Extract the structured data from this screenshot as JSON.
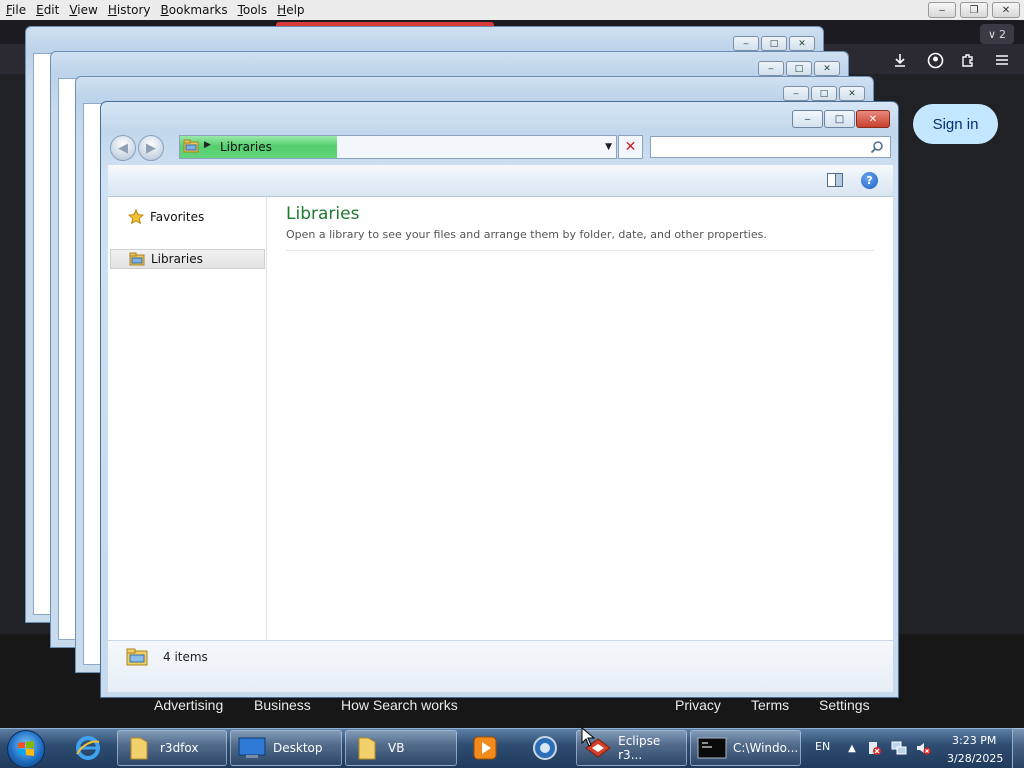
{
  "firefox": {
    "menu": [
      {
        "label": "File",
        "accel": "F",
        "rest": "ile"
      },
      {
        "label": "Edit",
        "accel": "E",
        "rest": "dit"
      },
      {
        "label": "View",
        "accel": "V",
        "rest": "iew"
      },
      {
        "label": "History",
        "accel": "H",
        "rest": "istory"
      },
      {
        "label": "Bookmarks",
        "accel": "B",
        "rest": "ookmarks"
      },
      {
        "label": "Tools",
        "accel": "T",
        "rest": "ools"
      },
      {
        "label": "Help",
        "accel": "H",
        "rest": "elp"
      }
    ],
    "tab_count": "2",
    "sign_in": "Sign in",
    "footer_links": [
      "Advertising",
      "Business",
      "How Search works",
      "Privacy",
      "Terms",
      "Settings"
    ]
  },
  "explorer": {
    "address": "Libraries",
    "address_progress": 0.36,
    "search_placeholder": "",
    "nav": {
      "favorites": "Favorites",
      "libraries": "Libraries"
    },
    "content": {
      "title": "Libraries",
      "description": "Open a library to see your files and arrange them by folder, date, and other properties."
    },
    "status": "4 items",
    "help_glyph": "?"
  },
  "taskbar": {
    "buttons": [
      "r3dfox",
      "Desktop",
      "VB",
      "Eclipse r3...",
      "C:\\Windo..."
    ],
    "language": "EN",
    "time": "3:23 PM",
    "date": "3/28/2025"
  },
  "colors": {
    "content_title": "#1e7a2e",
    "sign_in_bg": "#c2e7ff",
    "address_progress": "#55cf6e",
    "close_button": "#c7402c"
  }
}
